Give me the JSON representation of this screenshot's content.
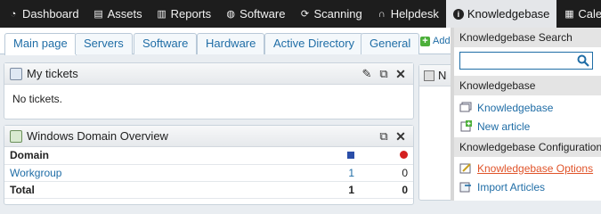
{
  "nav": {
    "items": [
      {
        "label": "Dashboard",
        "icon": "dashboard-icon"
      },
      {
        "label": "Assets",
        "icon": "assets-icon"
      },
      {
        "label": "Reports",
        "icon": "reports-icon"
      },
      {
        "label": "Software",
        "icon": "software-icon"
      },
      {
        "label": "Scanning",
        "icon": "scanning-icon"
      },
      {
        "label": "Helpdesk",
        "icon": "helpdesk-icon"
      },
      {
        "label": "Knowledgebase",
        "icon": "info-icon"
      },
      {
        "label": "Cale",
        "icon": "calendar-icon"
      }
    ]
  },
  "tabs": [
    {
      "label": "Main page"
    },
    {
      "label": "Servers"
    },
    {
      "label": "Software"
    },
    {
      "label": "Hardware"
    },
    {
      "label": "Active Directory"
    },
    {
      "label": "General"
    }
  ],
  "add_tab_label": "Add",
  "tickets": {
    "title": "My tickets",
    "empty": "No tickets."
  },
  "domain_overview": {
    "title": "Windows Domain Overview",
    "columns": [
      "Domain"
    ],
    "rows": [
      {
        "domain": "Workgroup",
        "a": "1",
        "b": "0"
      }
    ],
    "total": {
      "label": "Total",
      "a": "1",
      "b": "0"
    }
  },
  "stub_title": "N",
  "dropdown": {
    "search_header": "Knowledgebase Search",
    "search_value": "",
    "kb_header": "Knowledgebase",
    "kb_items": [
      "Knowledgebase",
      "New article"
    ],
    "config_header": "Knowledgebase Configuration",
    "config_items": [
      "Knowledgebase Options",
      "Import Articles"
    ]
  },
  "colors": {
    "link": "#1f6da6",
    "hover_link": "#e0542a",
    "nav_bg": "#1d1d1d"
  }
}
